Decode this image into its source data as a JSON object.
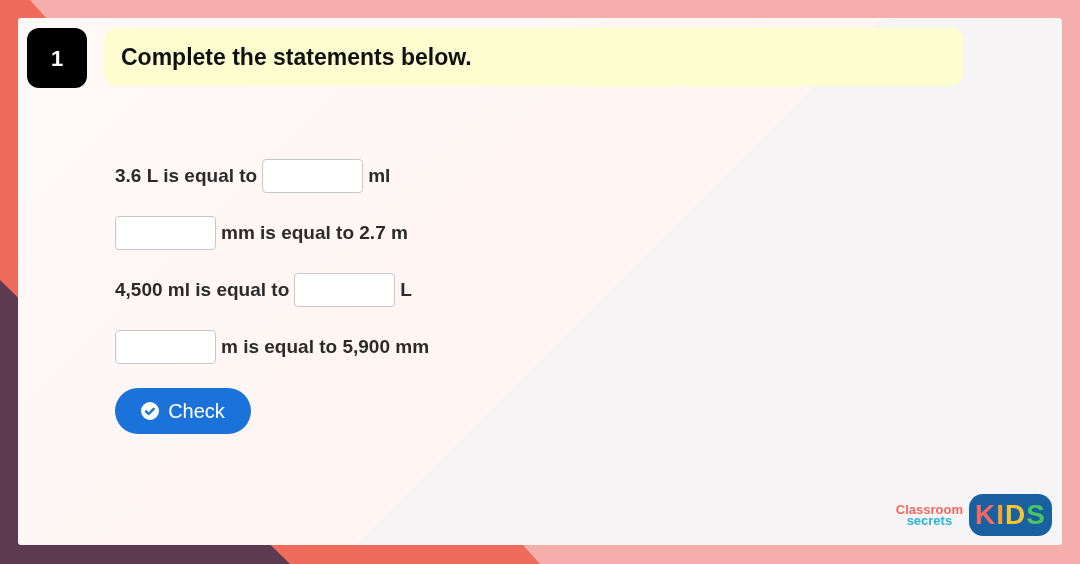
{
  "question": {
    "number": "1",
    "title": "Complete the statements below."
  },
  "statements": [
    {
      "parts": [
        {
          "kind": "text",
          "text": "3.6 L is equal to"
        },
        {
          "kind": "field"
        },
        {
          "kind": "text",
          "text": "ml"
        }
      ]
    },
    {
      "parts": [
        {
          "kind": "field"
        },
        {
          "kind": "text",
          "text": "mm is equal to 2.7 m"
        }
      ]
    },
    {
      "parts": [
        {
          "kind": "text",
          "text": "4,500 ml is equal to"
        },
        {
          "kind": "field"
        },
        {
          "kind": "text",
          "text": "L"
        }
      ]
    },
    {
      "parts": [
        {
          "kind": "field"
        },
        {
          "kind": "text",
          "text": "m is equal to 5,900 mm"
        }
      ]
    }
  ],
  "check_button": {
    "label": "Check"
  },
  "logo": {
    "line_1": "Classroom",
    "line_2": "secrets",
    "badge": "KIDS"
  }
}
